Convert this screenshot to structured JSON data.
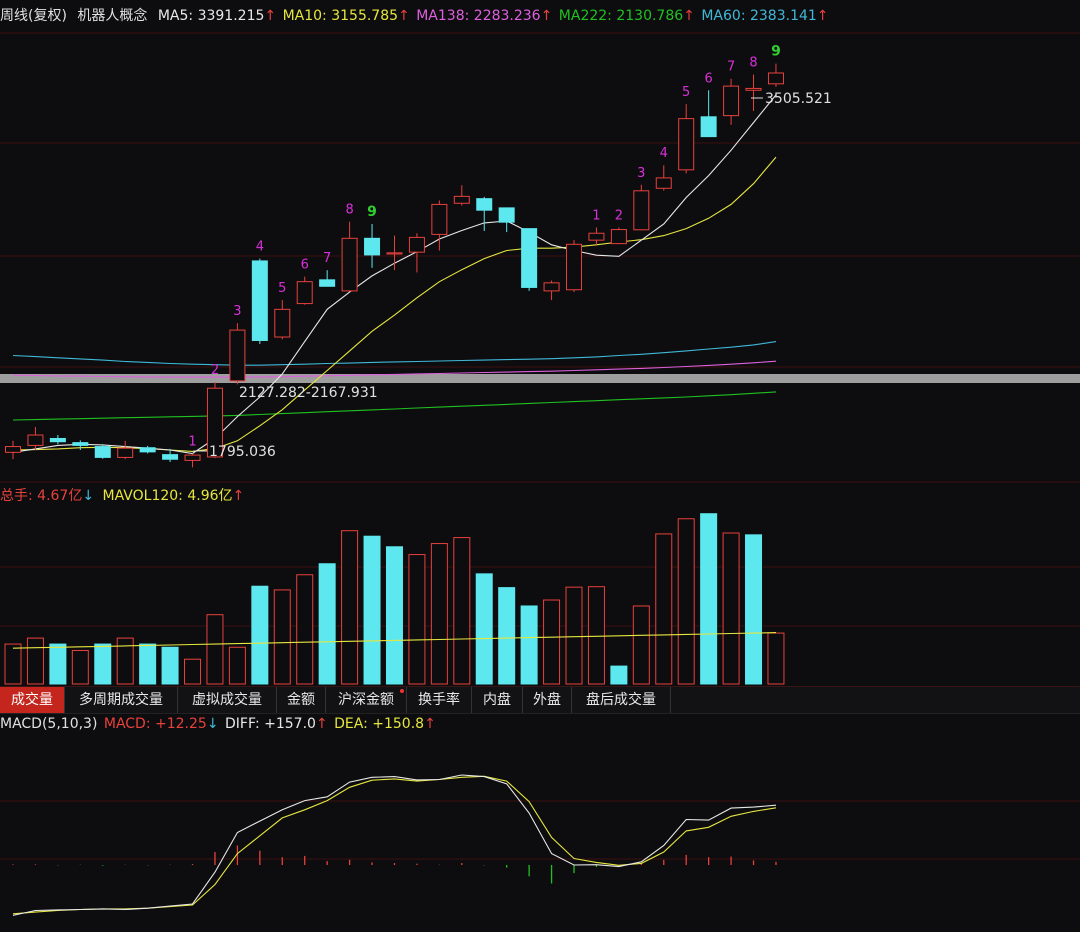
{
  "colors": {
    "up": "#e8413c",
    "down": "#5ce8ee",
    "ma5": "#e8e8e8",
    "ma10": "#e6e640",
    "ma138": "#dd60dd",
    "ma222": "#21c021",
    "ma60": "#40b8d8",
    "td": "#d830d8",
    "td9": "#30d030",
    "bg": "#0d0d0f",
    "grid": "#3a1010"
  },
  "price_header": {
    "period": "周线(复权)",
    "name": "机器人概念",
    "ma5_label": "MA5:",
    "ma5_value": "3391.215",
    "ma5_arrow": "↑",
    "ma10_label": "MA10:",
    "ma10_value": "3155.785",
    "ma10_arrow": "↑",
    "ma138_label": "MA138:",
    "ma138_value": "2283.236",
    "ma138_arrow": "↑",
    "ma222_label": "MA222:",
    "ma222_value": "2130.786",
    "ma222_arrow": "↑",
    "ma60_label": "MA60:",
    "ma60_value": "2383.141",
    "ma60_arrow": "↑"
  },
  "volume_header": {
    "label": "总手:",
    "value": "4.67亿",
    "arrow": "↓",
    "mavol_label": "MAVOL120:",
    "mavol_value": "4.96亿",
    "mavol_arrow": "↑"
  },
  "macd_header": {
    "label": "MACD(5,10,3)",
    "macd_label": "MACD:",
    "macd_value": "+12.25",
    "macd_arrow": "↓",
    "diff_label": "DIFF:",
    "diff_value": "+157.0",
    "diff_arrow": "↑",
    "dea_label": "DEA:",
    "dea_value": "+150.8",
    "dea_arrow": "↑"
  },
  "annotations": {
    "high": "3505.521",
    "low": "1795.036",
    "gap": "2127.282-2167.931"
  },
  "tabs": [
    "成交量",
    "多周期成交量",
    "虚拟成交量",
    "金额",
    "沪深金额",
    "换手率",
    "内盘",
    "外盘",
    "盘后成交量"
  ],
  "chart_data": {
    "type": "candlestick",
    "x_unit": "week",
    "candles": [
      {
        "o": 1820,
        "h": 1870,
        "l": 1790,
        "c": 1845
      },
      {
        "o": 1850,
        "h": 1930,
        "l": 1830,
        "c": 1895
      },
      {
        "o": 1880,
        "h": 1895,
        "l": 1855,
        "c": 1866
      },
      {
        "o": 1862,
        "h": 1872,
        "l": 1830,
        "c": 1850
      },
      {
        "o": 1845,
        "h": 1855,
        "l": 1792,
        "c": 1798
      },
      {
        "o": 1798,
        "h": 1870,
        "l": 1790,
        "c": 1838
      },
      {
        "o": 1840,
        "h": 1848,
        "l": 1815,
        "c": 1822
      },
      {
        "o": 1810,
        "h": 1835,
        "l": 1778,
        "c": 1790
      },
      {
        "o": 1785,
        "h": 1815,
        "l": 1755,
        "c": 1808
      },
      {
        "o": 1800,
        "h": 2125,
        "l": 1795,
        "c": 2098
      },
      {
        "o": 2130,
        "h": 2380,
        "l": 2115,
        "c": 2350
      },
      {
        "o": 2650,
        "h": 2660,
        "l": 2290,
        "c": 2305
      },
      {
        "o": 2320,
        "h": 2480,
        "l": 2310,
        "c": 2440
      },
      {
        "o": 2465,
        "h": 2582,
        "l": 2460,
        "c": 2560
      },
      {
        "o": 2568,
        "h": 2610,
        "l": 2550,
        "c": 2540
      },
      {
        "o": 2520,
        "h": 2820,
        "l": 2518,
        "c": 2748
      },
      {
        "o": 2748,
        "h": 2810,
        "l": 2620,
        "c": 2676
      },
      {
        "o": 2680,
        "h": 2760,
        "l": 2610,
        "c": 2685
      },
      {
        "o": 2688,
        "h": 2770,
        "l": 2600,
        "c": 2752
      },
      {
        "o": 2765,
        "h": 2912,
        "l": 2695,
        "c": 2895
      },
      {
        "o": 2900,
        "h": 2978,
        "l": 2890,
        "c": 2930
      },
      {
        "o": 2920,
        "h": 2928,
        "l": 2780,
        "c": 2870
      },
      {
        "o": 2880,
        "h": 2880,
        "l": 2775,
        "c": 2818
      },
      {
        "o": 2790,
        "h": 2790,
        "l": 2520,
        "c": 2535
      },
      {
        "o": 2520,
        "h": 2565,
        "l": 2480,
        "c": 2555
      },
      {
        "o": 2525,
        "h": 2740,
        "l": 2515,
        "c": 2722
      },
      {
        "o": 2740,
        "h": 2795,
        "l": 2720,
        "c": 2770
      },
      {
        "o": 2725,
        "h": 2795,
        "l": 2725,
        "c": 2786
      },
      {
        "o": 2785,
        "h": 2980,
        "l": 2782,
        "c": 2954
      },
      {
        "o": 2965,
        "h": 3065,
        "l": 2955,
        "c": 3010
      },
      {
        "o": 3045,
        "h": 3330,
        "l": 3030,
        "c": 3267
      },
      {
        "o": 3275,
        "h": 3390,
        "l": 3240,
        "c": 3189
      },
      {
        "o": 3280,
        "h": 3440,
        "l": 3240,
        "c": 3408
      },
      {
        "o": 3390,
        "h": 3458,
        "l": 3300,
        "c": 3398
      },
      {
        "o": 3418,
        "h": 3505.521,
        "l": 3405,
        "c": 3465
      }
    ],
    "td_labels": [
      {
        "i": 8,
        "t": "1"
      },
      {
        "i": 9,
        "t": "2"
      },
      {
        "i": 10,
        "t": "3"
      },
      {
        "i": 11,
        "t": "4"
      },
      {
        "i": 12,
        "t": "5"
      },
      {
        "i": 13,
        "t": "6"
      },
      {
        "i": 14,
        "t": "7"
      },
      {
        "i": 15,
        "t": "8"
      },
      {
        "i": 16,
        "t": "9"
      },
      {
        "i": 26,
        "t": "1"
      },
      {
        "i": 27,
        "t": "2"
      },
      {
        "i": 28,
        "t": "3"
      },
      {
        "i": 29,
        "t": "4"
      },
      {
        "i": 30,
        "t": "5"
      },
      {
        "i": 31,
        "t": "6"
      },
      {
        "i": 32,
        "t": "7"
      },
      {
        "i": 33,
        "t": "8"
      },
      {
        "i": 34,
        "t": "9"
      }
    ],
    "ma5": [
      1820,
      1835,
      1850,
      1855,
      1852,
      1845,
      1838,
      1830,
      1815,
      1880,
      1975,
      2060,
      2160,
      2300,
      2440,
      2515,
      2585,
      2640,
      2690,
      2745,
      2782,
      2815,
      2823,
      2775,
      2720,
      2695,
      2675,
      2670,
      2740,
      2810,
      2925,
      3020,
      3130,
      3250,
      3370
    ],
    "ma10": [
      1830,
      1832,
      1835,
      1840,
      1842,
      1840,
      1836,
      1830,
      1824,
      1836,
      1870,
      1935,
      2005,
      2090,
      2175,
      2260,
      2345,
      2415,
      2490,
      2560,
      2612,
      2660,
      2695,
      2705,
      2705,
      2710,
      2720,
      2732,
      2742,
      2760,
      2790,
      2835,
      2895,
      2985,
      3100
    ],
    "ma60": [
      2240,
      2235,
      2230,
      2225,
      2220,
      2214,
      2210,
      2205,
      2202,
      2200,
      2198,
      2198,
      2200,
      2202,
      2205,
      2207,
      2210,
      2212,
      2214,
      2216,
      2218,
      2220,
      2222,
      2224,
      2226,
      2230,
      2234,
      2240,
      2245,
      2252,
      2260,
      2268,
      2276,
      2286,
      2300
    ],
    "ma138": [
      2155,
      2153,
      2151,
      2150,
      2149,
      2148,
      2147,
      2146,
      2146,
      2146,
      2146,
      2147,
      2148,
      2150,
      2152,
      2154,
      2156,
      2158,
      2160,
      2162,
      2164,
      2166,
      2168,
      2170,
      2172,
      2175,
      2178,
      2181,
      2184,
      2188,
      2192,
      2197,
      2202,
      2208,
      2215
    ],
    "ma222": [
      1960,
      1962,
      1964,
      1966,
      1968,
      1970,
      1972,
      1974,
      1976,
      1978,
      1980,
      1984,
      1988,
      1992,
      1996,
      2000,
      2004,
      2008,
      2012,
      2016,
      2020,
      2024,
      2028,
      2032,
      2036,
      2040,
      2044,
      2048,
      2052,
      2056,
      2060,
      2065,
      2070,
      2076,
      2082
    ],
    "price_range": [
      1700,
      3660
    ],
    "volume": [
      0.87,
      1.0,
      0.87,
      0.73,
      0.87,
      1.0,
      0.87,
      0.8,
      0.54,
      1.51,
      0.8,
      2.13,
      2.05,
      2.38,
      2.62,
      3.34,
      3.22,
      2.99,
      2.82,
      3.06,
      3.19,
      2.4,
      2.1,
      1.7,
      1.83,
      2.11,
      2.12,
      0.39,
      1.7,
      3.27,
      3.6,
      3.71,
      3.29,
      3.25,
      1.11
    ],
    "volume_up": [
      true,
      true,
      false,
      true,
      false,
      true,
      false,
      false,
      true,
      true,
      true,
      false,
      true,
      true,
      false,
      true,
      false,
      false,
      true,
      true,
      true,
      false,
      false,
      false,
      true,
      true,
      true,
      false,
      true,
      true,
      true,
      false,
      true,
      false,
      true
    ],
    "mavol": [
      0.78,
      0.79,
      0.8,
      0.81,
      0.82,
      0.83,
      0.84,
      0.85,
      0.86,
      0.87,
      0.88,
      0.89,
      0.9,
      0.91,
      0.92,
      0.93,
      0.94,
      0.95,
      0.96,
      0.97,
      0.98,
      0.99,
      1.0,
      1.01,
      1.02,
      1.03,
      1.04,
      1.05,
      1.06,
      1.07,
      1.08,
      1.09,
      1.1,
      1.11,
      1.12
    ],
    "volume_range": [
      0,
      3.9
    ],
    "diff": [
      -155,
      -140,
      -138,
      -137,
      -135,
      -137,
      -133,
      -126,
      -120,
      -22,
      100,
      135,
      170,
      198,
      210,
      255,
      270,
      272,
      262,
      263,
      277,
      272,
      250,
      160,
      35,
      0,
      1,
      -5,
      10,
      60,
      140,
      138,
      175,
      178,
      184
    ],
    "dea": [
      -150,
      -145,
      -140,
      -137,
      -135,
      -135,
      -133,
      -128,
      -123,
      -60,
      35,
      90,
      145,
      170,
      198,
      239,
      261,
      265,
      258,
      263,
      270,
      273,
      258,
      195,
      85,
      20,
      8,
      -1,
      5,
      40,
      105,
      116,
      150,
      165,
      176
    ],
    "macd": [
      2,
      2,
      -1,
      1,
      -2,
      1,
      -1,
      1,
      3,
      40,
      60,
      44,
      24,
      28,
      12,
      16,
      8,
      6,
      4,
      1,
      6,
      -1,
      -8,
      -35,
      -57,
      -25,
      -6,
      -4,
      5,
      16,
      31,
      24,
      26,
      14,
      10
    ],
    "macd_range": [
      -200,
      400
    ]
  }
}
